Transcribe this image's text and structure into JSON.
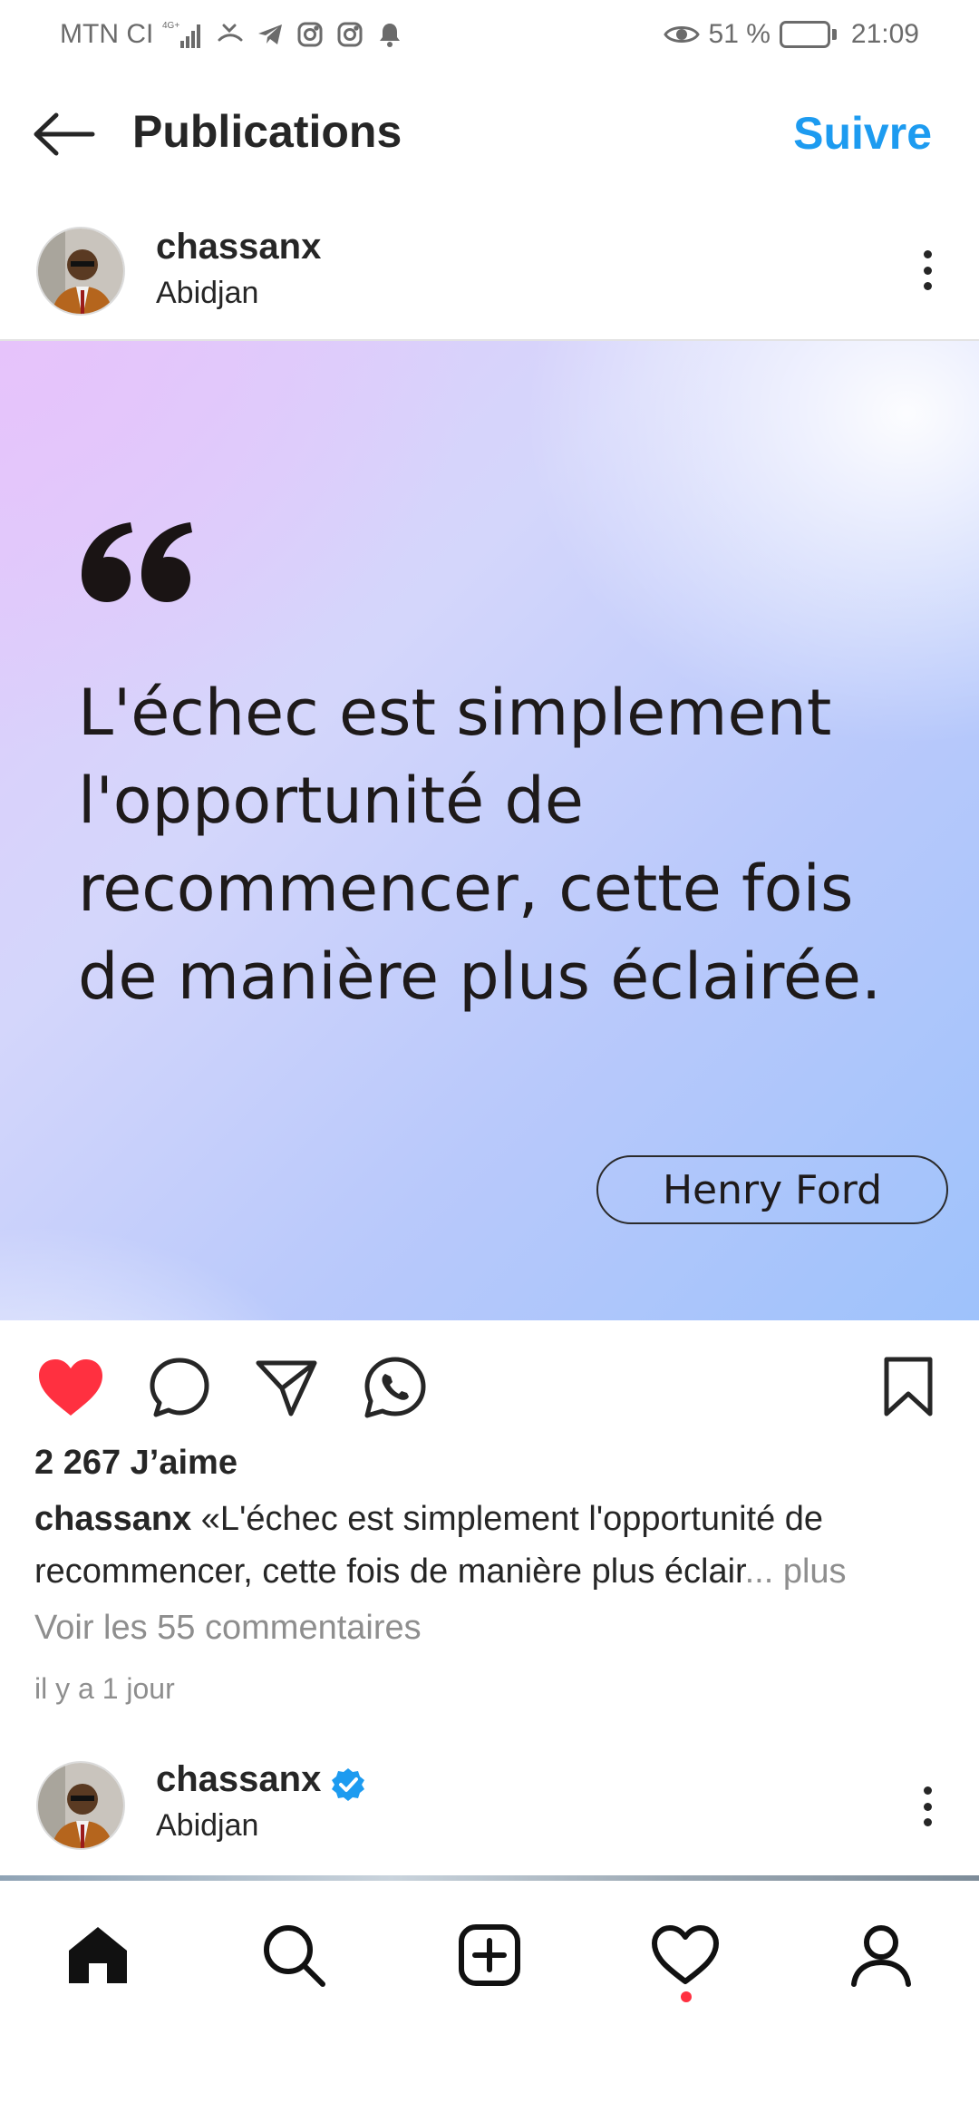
{
  "status_bar": {
    "carrier": "MTN CI",
    "network": "4G+",
    "battery_percent": "51 %",
    "battery_level": 0.51,
    "time": "21:09",
    "icons": [
      "signal-icon",
      "missed-call-icon",
      "telegram-icon",
      "instagram-icon",
      "instagram-icon",
      "alarm-icon",
      "eye-icon",
      "battery-icon"
    ]
  },
  "header": {
    "title": "Publications",
    "follow_label": "Suivre"
  },
  "post": {
    "username": "chassanx",
    "location": "Abidjan",
    "image": {
      "quote": "L'échec est simplement l'opportunité de recommencer, cette fois de manière plus éclairée.",
      "author": "Henry Ford"
    },
    "likes": "2 267 J’aime",
    "caption_user": "chassanx",
    "caption_text": "«L'échec est simplement l'opportunité de recommencer, cette fois de manière plus éclair",
    "caption_more": "... plus",
    "comments_link": "Voir les 55 commentaires",
    "timestamp": "il y a 1 jour",
    "liked": true,
    "colors": {
      "like": "#ff3040",
      "follow": "#1d9bf0"
    }
  },
  "next_post": {
    "username": "chassanx",
    "location": "Abidjan",
    "verified": true
  },
  "bottom_nav": {
    "items": [
      "home-icon",
      "search-icon",
      "create-icon",
      "activity-icon",
      "profile-icon"
    ],
    "active": "home-icon"
  }
}
